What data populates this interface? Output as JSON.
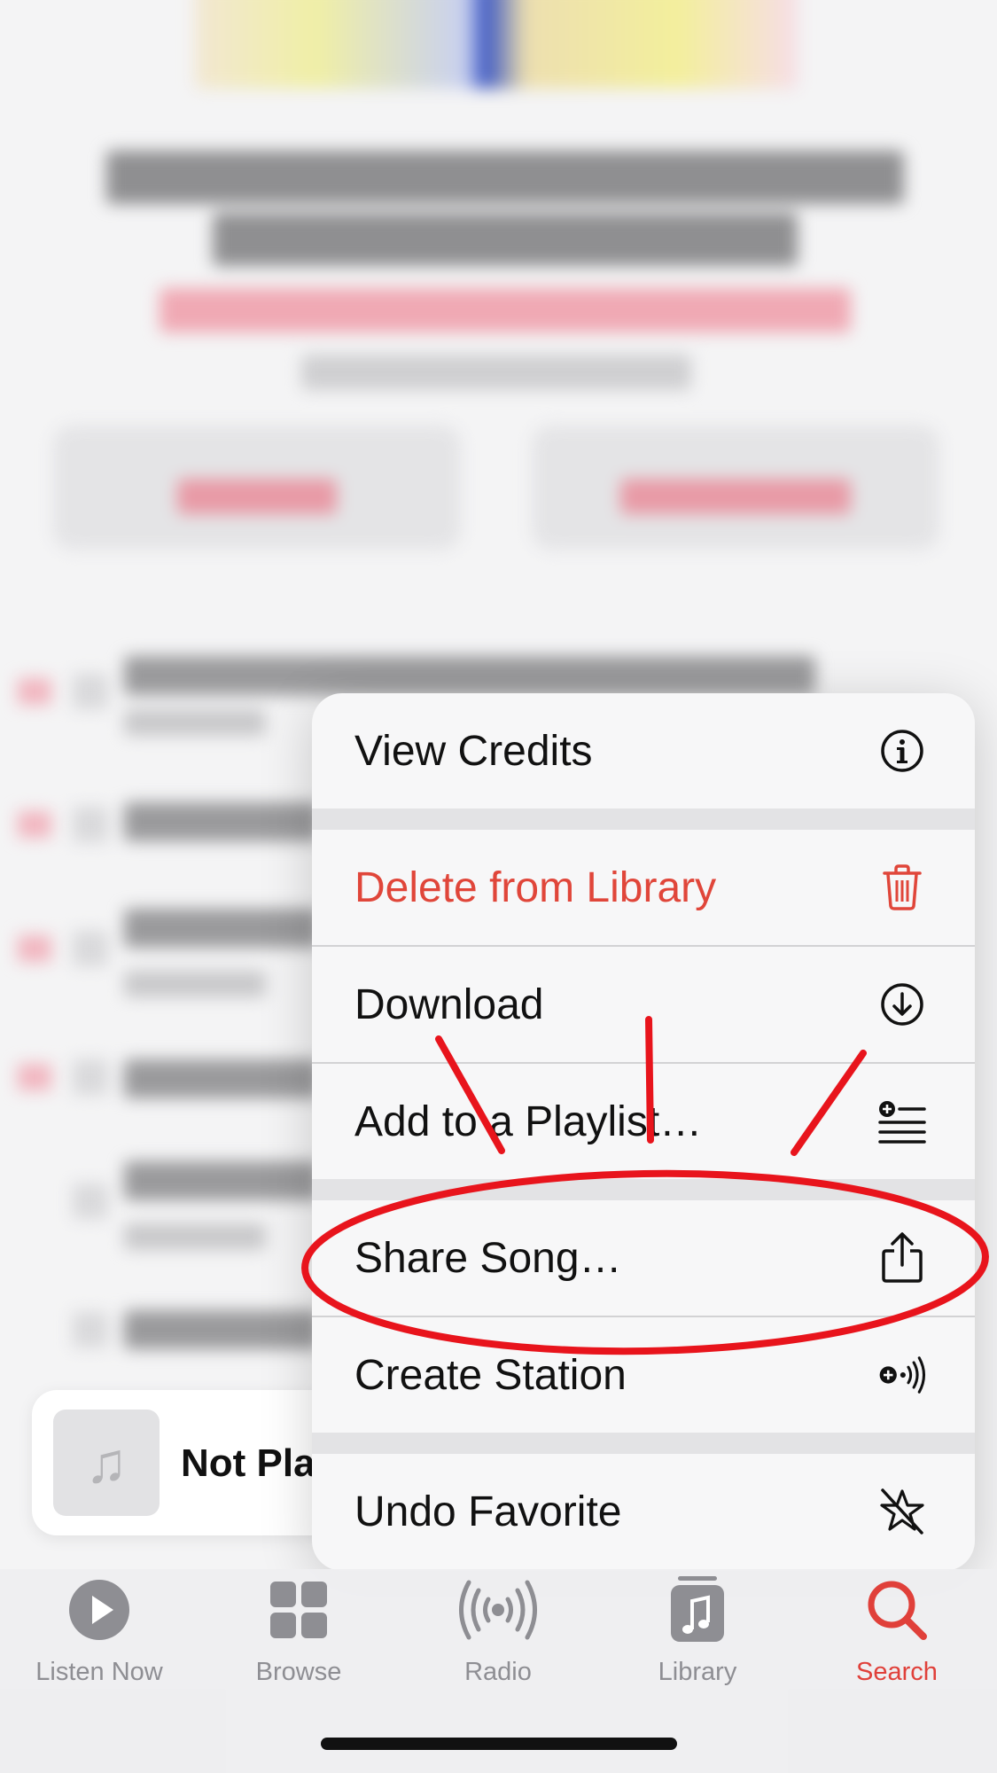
{
  "menu": {
    "items": [
      {
        "label": "View Credits",
        "icon": "info-icon"
      },
      {
        "label": "Delete from Library",
        "icon": "trash-icon"
      },
      {
        "label": "Download",
        "icon": "download-icon"
      },
      {
        "label": "Add to a Playlist…",
        "icon": "add-to-playlist-icon"
      },
      {
        "label": "Share Song…",
        "icon": "share-icon"
      },
      {
        "label": "Create Station",
        "icon": "create-station-icon"
      },
      {
        "label": "Undo Favorite",
        "icon": "undo-favorite-star-icon"
      }
    ]
  },
  "mini_player": {
    "title": "Not Pla",
    "artwork_icon": "music-note-icon"
  },
  "tabbar": {
    "tabs": [
      {
        "label": "Listen Now",
        "icon": "play-circle-icon",
        "active": false
      },
      {
        "label": "Browse",
        "icon": "grid-icon",
        "active": false
      },
      {
        "label": "Radio",
        "icon": "radio-waves-icon",
        "active": false
      },
      {
        "label": "Library",
        "icon": "music-library-icon",
        "active": false
      },
      {
        "label": "Search",
        "icon": "search-icon",
        "active": true
      }
    ]
  },
  "colors": {
    "accent": "#e0403a",
    "destructive": "#e0463a",
    "annotation": "#e8141c",
    "inactive_tab": "#8e8e93"
  }
}
